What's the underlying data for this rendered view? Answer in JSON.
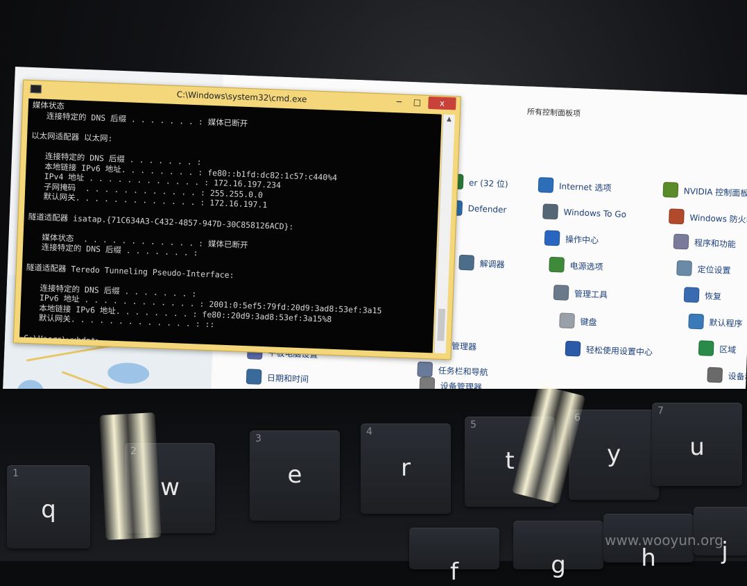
{
  "cmd": {
    "title": "C:\\Windows\\system32\\cmd.exe",
    "buttons": {
      "minimize": "−",
      "maximize": "□",
      "close": "x"
    },
    "lines": [
      "媒体状态",
      "   连接特定的 DNS 后缀 . . . . . . . : 媒体已断开",
      "",
      "以太网适配器 以太网:",
      "",
      "   连接特定的 DNS 后缀 . . . . . . . :",
      "   本地链接 IPv6 地址. . . . . . . . : fe80::b1fd:dc82:1c57:c440%4",
      "   IPv4 地址 . . . . . . . . . . . . : 172.16.197.234",
      "   子网掩码  . . . . . . . . . . . . : 255.255.0.0",
      "   默认网关. . . . . . . . . . . . . : 172.16.197.1",
      "",
      "隧道适配器 isatap.{71C634A3-C432-4857-947D-30C858126ACD}:",
      "",
      "   媒体状态  . . . . . . . . . . . . : 媒体已断开",
      "   连接特定的 DNS 后缀 . . . . . . . :",
      "",
      "隧道适配器 Teredo Tunneling Pseudo-Interface:",
      "",
      "   连接特定的 DNS 后缀 . . . . . . . :",
      "   IPv6 地址 . . . . . . . . . . . . : 2001:0:5ef5:79fd:20d9:3ad8:53ef:3a15",
      "   本地链接 IPv6 地址. . . . . . . . : fe80::20d9:3ad8:53ef:3a15%8",
      "   默认网关. . . . . . . . . . . . . : ::",
      "",
      "C:\\Users\\wxhdpt>_",
      "微软拼音 半 :"
    ]
  },
  "control_panel": {
    "title": "所有控制面板项",
    "items": [
      {
        "label": "er (32 位)",
        "icon": "java-icon"
      },
      {
        "label": "Internet 选项",
        "icon": "globe-icon"
      },
      {
        "label": "NVIDIA 控制面板",
        "icon": "nvidia-icon"
      },
      {
        "label": "Defender",
        "icon": "defender-icon"
      },
      {
        "label": "Windows To Go",
        "icon": "usb-drive-icon"
      },
      {
        "label": "Windows 防火墙",
        "icon": "firewall-icon"
      },
      {
        "label": "操作中心",
        "icon": "flag-icon"
      },
      {
        "label": "程序和功能",
        "icon": "programs-icon"
      },
      {
        "label": "解调器",
        "icon": "modem-icon"
      },
      {
        "label": "电源选项",
        "icon": "power-icon"
      },
      {
        "label": "定位设置",
        "icon": "location-icon"
      },
      {
        "label": "管理工具",
        "icon": "admin-tools-icon"
      },
      {
        "label": "恢复",
        "icon": "recovery-icon"
      },
      {
        "label": "键盘",
        "icon": "keyboard-icon"
      },
      {
        "label": "默认程序",
        "icon": "default-programs-icon"
      },
      {
        "label": "凭据管理器",
        "icon": "credential-icon"
      },
      {
        "label": "轻松使用设置中心",
        "icon": "ease-of-access-icon"
      },
      {
        "label": "区域",
        "icon": "region-icon"
      },
      {
        "label": "平板电脑设置",
        "icon": "tablet-icon"
      },
      {
        "label": "任务栏和导航",
        "icon": "taskbar-icon"
      },
      {
        "label": "日期和时间",
        "icon": "clock-icon"
      },
      {
        "label": "设备管理器",
        "icon": "device-manager-icon"
      },
      {
        "label": "设备和",
        "icon": "devices-icon"
      }
    ]
  },
  "keyboard": {
    "keys": [
      {
        "num": "1",
        "ch": "q"
      },
      {
        "num": "2",
        "ch": "w"
      },
      {
        "num": "3",
        "ch": "e"
      },
      {
        "num": "4",
        "ch": "r"
      },
      {
        "num": "5",
        "ch": "t"
      },
      {
        "num": "6",
        "ch": "y"
      },
      {
        "num": "7",
        "ch": "u"
      },
      {
        "num": "",
        "ch": "f"
      },
      {
        "num": "",
        "ch": "g"
      },
      {
        "num": "",
        "ch": "h"
      },
      {
        "num": "",
        "ch": "j"
      }
    ]
  },
  "watermark": "www.wooyun.org"
}
